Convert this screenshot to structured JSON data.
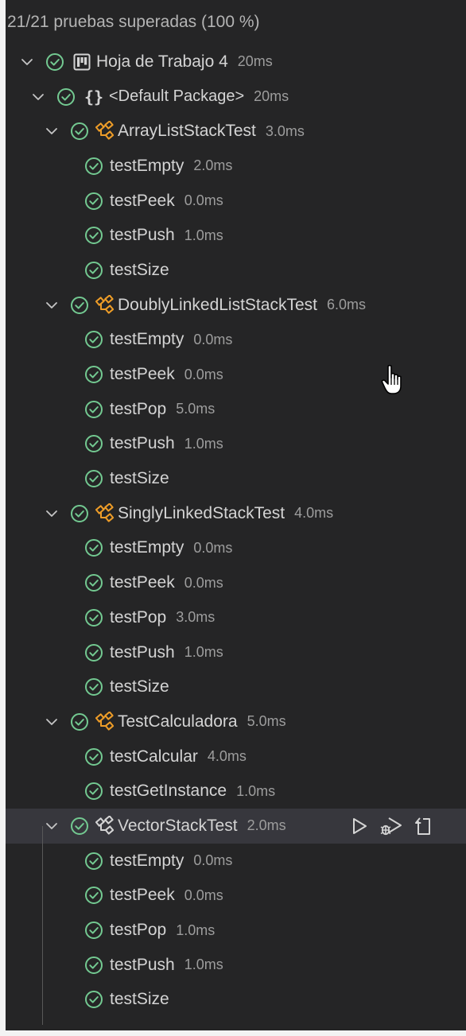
{
  "summary": "21/21 pruebas superadas (100 %)",
  "colors": {
    "panel_bg": "#252526",
    "page_bg": "#f3f3f3",
    "pass_green": "#73c991",
    "class_orange": "#ee9d28",
    "text": "#d4d4d4",
    "duration": "#9d9d9d",
    "selected_row": "#37373d"
  },
  "tree": [
    {
      "kind": "root",
      "label": "Hoja de Trabajo 4",
      "duration": "20ms",
      "icon": "project-board-icon",
      "status": "passed"
    },
    {
      "kind": "package",
      "label": "<Default Package>",
      "duration": "20ms",
      "icon": "braces-icon",
      "status": "passed"
    },
    {
      "kind": "class",
      "label": "ArrayListStackTest",
      "duration": "3.0ms",
      "icon": "class-icon",
      "status": "passed"
    },
    {
      "kind": "test",
      "label": "testEmpty",
      "duration": "2.0ms",
      "status": "passed"
    },
    {
      "kind": "test",
      "label": "testPeek",
      "duration": "0.0ms",
      "status": "passed"
    },
    {
      "kind": "test",
      "label": "testPush",
      "duration": "1.0ms",
      "status": "passed"
    },
    {
      "kind": "test",
      "label": "testSize",
      "duration": "",
      "status": "passed"
    },
    {
      "kind": "class",
      "label": "DoublyLinkedListStackTest",
      "duration": "6.0ms",
      "icon": "class-icon",
      "status": "passed"
    },
    {
      "kind": "test",
      "label": "testEmpty",
      "duration": "0.0ms",
      "status": "passed"
    },
    {
      "kind": "test",
      "label": "testPeek",
      "duration": "0.0ms",
      "status": "passed"
    },
    {
      "kind": "test",
      "label": "testPop",
      "duration": "5.0ms",
      "status": "passed"
    },
    {
      "kind": "test",
      "label": "testPush",
      "duration": "1.0ms",
      "status": "passed"
    },
    {
      "kind": "test",
      "label": "testSize",
      "duration": "",
      "status": "passed"
    },
    {
      "kind": "class",
      "label": "SinglyLinkedStackTest",
      "duration": "4.0ms",
      "icon": "class-icon",
      "status": "passed"
    },
    {
      "kind": "test",
      "label": "testEmpty",
      "duration": "0.0ms",
      "status": "passed"
    },
    {
      "kind": "test",
      "label": "testPeek",
      "duration": "0.0ms",
      "status": "passed"
    },
    {
      "kind": "test",
      "label": "testPop",
      "duration": "3.0ms",
      "status": "passed"
    },
    {
      "kind": "test",
      "label": "testPush",
      "duration": "1.0ms",
      "status": "passed"
    },
    {
      "kind": "test",
      "label": "testSize",
      "duration": "",
      "status": "passed"
    },
    {
      "kind": "class",
      "label": "TestCalculadora",
      "duration": "5.0ms",
      "icon": "class-icon",
      "status": "passed"
    },
    {
      "kind": "test",
      "label": "testCalcular",
      "duration": "4.0ms",
      "status": "passed"
    },
    {
      "kind": "test",
      "label": "testGetInstance",
      "duration": "1.0ms",
      "status": "passed"
    },
    {
      "kind": "class",
      "label": "VectorStackTest",
      "duration": "2.0ms",
      "icon": "class-icon",
      "status": "passed",
      "selected": true,
      "actions": [
        "run-test-icon",
        "debug-test-icon",
        "go-to-test-icon"
      ]
    },
    {
      "kind": "test",
      "label": "testEmpty",
      "duration": "0.0ms",
      "status": "passed"
    },
    {
      "kind": "test",
      "label": "testPeek",
      "duration": "0.0ms",
      "status": "passed"
    },
    {
      "kind": "test",
      "label": "testPop",
      "duration": "1.0ms",
      "status": "passed"
    },
    {
      "kind": "test",
      "label": "testPush",
      "duration": "1.0ms",
      "status": "passed"
    },
    {
      "kind": "test",
      "label": "testSize",
      "duration": "",
      "status": "passed"
    }
  ]
}
